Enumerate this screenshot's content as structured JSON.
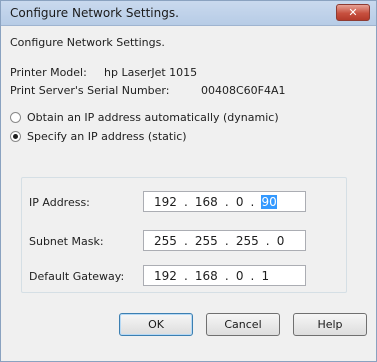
{
  "window": {
    "title": "Configure Network Settings.",
    "close_glyph": "✕"
  },
  "info": {
    "heading": "Configure Network Settings.",
    "printer_model_label": "Printer Model:",
    "printer_model_value": "hp LaserJet 1015",
    "serial_label": "Print Server's Serial Number:",
    "serial_value": "00408C60F4A1"
  },
  "ip_mode": {
    "options": [
      {
        "label": "Obtain an IP address automatically (dynamic)",
        "checked": false
      },
      {
        "label": "Specify an IP address (static)",
        "checked": true
      }
    ]
  },
  "fields": [
    {
      "label": "IP Address:",
      "octets": [
        "192",
        "168",
        "0",
        "90"
      ],
      "selected_octet": 3
    },
    {
      "label": "Subnet Mask:",
      "octets": [
        "255",
        "255",
        "255",
        "0"
      ],
      "selected_octet": -1
    },
    {
      "label": "Default Gateway:",
      "octets": [
        "192",
        "168",
        "0",
        "1"
      ],
      "selected_octet": -1
    }
  ],
  "buttons": {
    "ok": "OK",
    "cancel": "Cancel",
    "help": "Help"
  }
}
